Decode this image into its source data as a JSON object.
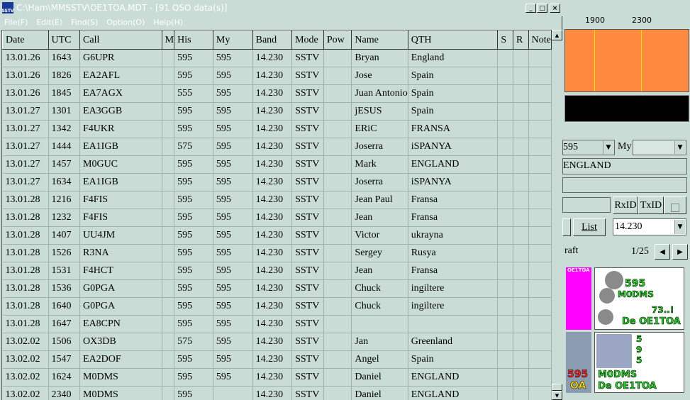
{
  "window": {
    "title": "C:\\Ham\\MMSSTV\\OE1TOA.MDT - [91 QSO data(s)]",
    "app_icon_text": "SSTV",
    "minimize": "_",
    "maximize": "□",
    "close": "×"
  },
  "menu": [
    "File(F)",
    "Edit(E)",
    "Find(S)",
    "Option(O)",
    "Help(H)"
  ],
  "table": {
    "columns": [
      "Date",
      "UTC",
      "Call",
      "M",
      "His",
      "My",
      "Band",
      "Mode",
      "Pow",
      "Name",
      "QTH",
      "S",
      "R",
      "Note"
    ],
    "rows": [
      [
        "13.01.26",
        "1643",
        "G6UPR",
        "",
        "595",
        "595",
        "14.230",
        "SSTV",
        "",
        "Bryan",
        "England",
        "",
        "",
        ""
      ],
      [
        "13.01.26",
        "1826",
        "EA2AFL",
        "",
        "595",
        "595",
        "14.230",
        "SSTV",
        "",
        "Jose",
        "Spain",
        "",
        "",
        ""
      ],
      [
        "13.01.26",
        "1845",
        "EA7AGX",
        "",
        "555",
        "595",
        "14.230",
        "SSTV",
        "",
        "Juan Antonio",
        "Spain",
        "",
        "",
        ""
      ],
      [
        "13.01.27",
        "1301",
        "EA3GGB",
        "",
        "595",
        "595",
        "14.230",
        "SSTV",
        "",
        "jESUS",
        "Spain",
        "",
        "",
        ""
      ],
      [
        "13.01.27",
        "1342",
        "F4UKR",
        "",
        "595",
        "595",
        "14.230",
        "SSTV",
        "",
        "ERiC",
        "FRANSA",
        "",
        "",
        ""
      ],
      [
        "13.01.27",
        "1444",
        "EA1IGB",
        "",
        "575",
        "595",
        "14.230",
        "SSTV",
        "",
        "Joserra",
        "iSPANYA",
        "",
        "",
        ""
      ],
      [
        "13.01.27",
        "1457",
        "M0GUC",
        "",
        "595",
        "595",
        "14.230",
        "SSTV",
        "",
        "Mark",
        "ENGLAND",
        "",
        "",
        ""
      ],
      [
        "13.01.27",
        "1634",
        "EA1IGB",
        "",
        "595",
        "595",
        "14.230",
        "SSTV",
        "",
        "Joserra",
        "iSPANYA",
        "",
        "",
        ""
      ],
      [
        "13.01.28",
        "1216",
        "F4FIS",
        "",
        "595",
        "595",
        "14.230",
        "SSTV",
        "",
        "Jean Paul",
        "Fransa",
        "",
        "",
        ""
      ],
      [
        "13.01.28",
        "1232",
        "F4FIS",
        "",
        "595",
        "595",
        "14.230",
        "SSTV",
        "",
        "Jean",
        "Fransa",
        "",
        "",
        ""
      ],
      [
        "13.01.28",
        "1407",
        "UU4JM",
        "",
        "595",
        "595",
        "14.230",
        "SSTV",
        "",
        "Victor",
        "ukrayna",
        "",
        "",
        ""
      ],
      [
        "13.01.28",
        "1526",
        "R3NA",
        "",
        "595",
        "595",
        "14.230",
        "SSTV",
        "",
        "Sergey",
        "Rusya",
        "",
        "",
        ""
      ],
      [
        "13.01.28",
        "1531",
        "F4HCT",
        "",
        "595",
        "595",
        "14.230",
        "SSTV",
        "",
        "Jean",
        "Fransa",
        "",
        "",
        ""
      ],
      [
        "13.01.28",
        "1536",
        "G0PGA",
        "",
        "595",
        "595",
        "14.230",
        "SSTV",
        "",
        "Chuck",
        "ingiltere",
        "",
        "",
        ""
      ],
      [
        "13.01.28",
        "1640",
        "G0PGA",
        "",
        "595",
        "595",
        "14.230",
        "SSTV",
        "",
        "Chuck",
        "ingiltere",
        "",
        "",
        ""
      ],
      [
        "13.01.28",
        "1647",
        "EA8CPN",
        "",
        "595",
        "595",
        "14.230",
        "SSTV",
        "",
        "",
        "",
        "",
        "",
        ""
      ],
      [
        "13.02.02",
        "1506",
        "OX3DB",
        "",
        "575",
        "595",
        "14.230",
        "SSTV",
        "",
        "Jan",
        "Greenland",
        "",
        "",
        ""
      ],
      [
        "13.02.02",
        "1547",
        "EA2DOF",
        "",
        "595",
        "595",
        "14.230",
        "SSTV",
        "",
        "Angel",
        "Spain",
        "",
        "",
        ""
      ],
      [
        "13.02.02",
        "1624",
        "M0DMS",
        "",
        "595",
        "595",
        "14.230",
        "SSTV",
        "",
        "Daniel",
        "ENGLAND",
        "",
        "",
        ""
      ],
      [
        "13.02.02",
        "2340",
        "M0DMS",
        "",
        "595",
        "",
        "14.230",
        "SSTV",
        "",
        "Daniel",
        "ENGLAND",
        "",
        "",
        ""
      ]
    ]
  },
  "right_panel": {
    "freq_1900": "1900",
    "freq_2300": "2300",
    "his_value": "595",
    "my_label": "My",
    "qth_value": "ENGLAND",
    "rxid_label": "RxID",
    "txid_label": "TxID",
    "list_label": "List",
    "band_value": "14.230",
    "draft_label": "raft",
    "page_indicator": "1/25",
    "prev_label": "◀",
    "next_label": "▶",
    "pic_callsign_1": "OE1TOA",
    "pic_text_595": "595",
    "pic_text_m0dms": "M0DMS",
    "pic_text_73": "73..!",
    "pic_text_de": "De OE1TOA",
    "pic_text_595b": "5 9 5",
    "pic_text_m0dms2": "M0DMS",
    "pic_text_de2": "De OE1TOA",
    "pic_text_595c": "595",
    "pic_text_oe": "OA"
  },
  "colors": {
    "titlebar": "#c9ddd6",
    "spectrum": "#fd8a3f",
    "marker": "#ffe600",
    "grid_bg": "#c9ddd6"
  }
}
